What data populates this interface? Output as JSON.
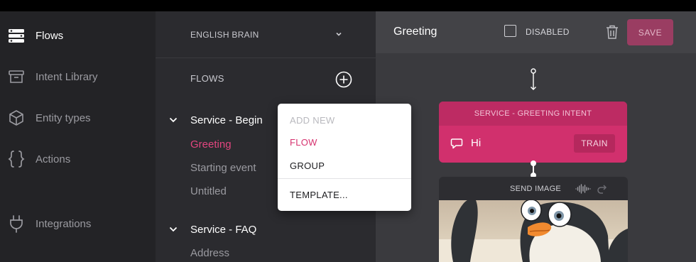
{
  "nav": {
    "items": [
      {
        "label": "Flows",
        "icon": "flows-icon",
        "active": true
      },
      {
        "label": "Intent Library",
        "icon": "archive-icon"
      },
      {
        "label": "Entity types",
        "icon": "cube-icon"
      },
      {
        "label": "Actions",
        "icon": "braces-icon"
      },
      {
        "label": "Integrations",
        "icon": "plug-icon"
      }
    ]
  },
  "flows_panel": {
    "brain": "ENGLISH BRAIN",
    "section_label": "FLOWS",
    "groups": [
      {
        "label": "Service - Begin",
        "items": [
          "Greeting",
          "Starting event",
          "Untitled"
        ]
      },
      {
        "label": "Service - FAQ",
        "items": [
          "Address"
        ]
      }
    ]
  },
  "add_menu": {
    "header": "ADD NEW",
    "items": [
      "FLOW",
      "GROUP",
      "TEMPLATE..."
    ]
  },
  "canvas": {
    "title": "Greeting",
    "disabled_label": "DISABLED",
    "disabled_checked": false,
    "save_label": "SAVE",
    "intent_node": {
      "header": "SERVICE - GREETING INTENT",
      "text": "Hi",
      "train_label": "TRAIN"
    },
    "image_node": {
      "header": "SEND IMAGE"
    }
  },
  "colors": {
    "accent": "#d1306d",
    "nav_bg": "#232326",
    "panel_bg": "#2b2b2f",
    "canvas_bg": "#3a3a3e"
  }
}
